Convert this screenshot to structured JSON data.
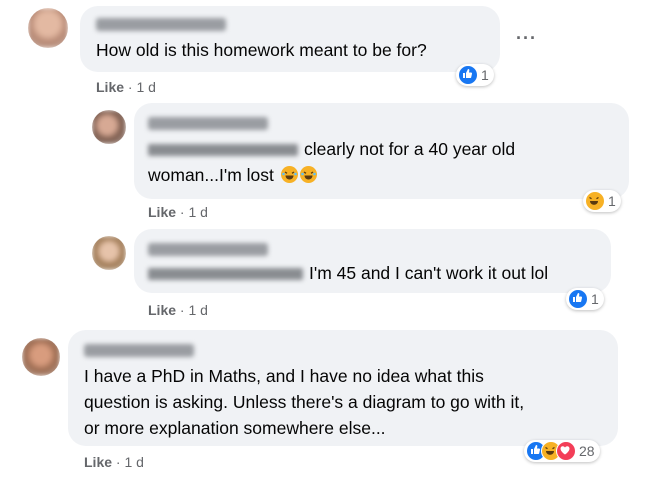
{
  "comments": [
    {
      "text_lines": [
        "How old is this homework meant to be for?"
      ],
      "like_label": "Like",
      "time": "· 1 d",
      "reaction_count": "1",
      "more": "···"
    },
    {
      "text_lines": [
        "clearly not for a 40 year old",
        "woman...I'm lost"
      ],
      "like_label": "Like",
      "time": "· 1 d",
      "reaction_count": "1"
    },
    {
      "text_lines": [
        "I'm 45 and I can't work it out lol"
      ],
      "like_label": "Like",
      "time": "· 1 d",
      "reaction_count": "1"
    },
    {
      "text_lines": [
        "I have a PhD in Maths, and I have no idea what this",
        "question is asking. Unless there's a diagram to go with it,",
        "or more explanation somewhere else..."
      ],
      "like_label": "Like",
      "time": "· 1 d",
      "reaction_count": "28"
    }
  ],
  "colors": {
    "bubble": "#f0f2f5",
    "like_blue": "#1877f2",
    "haha_yellow": "#f7b125",
    "love_red": "#f33e58",
    "meta_gray": "#65676b"
  },
  "icons": [
    "avatar",
    "like-reaction-icon",
    "haha-reaction-icon",
    "love-reaction-icon",
    "more-options-icon"
  ]
}
